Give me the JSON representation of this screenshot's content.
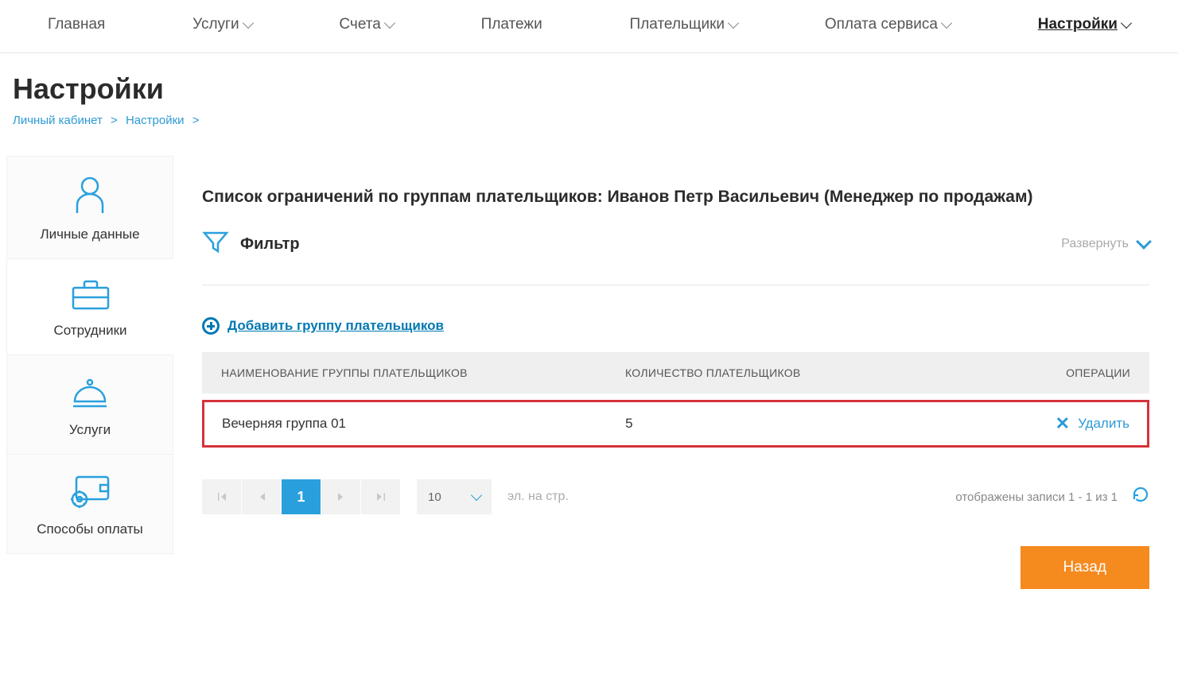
{
  "nav": {
    "items": [
      {
        "label": "Главная",
        "has_chevron": false
      },
      {
        "label": "Услуги",
        "has_chevron": true
      },
      {
        "label": "Счета",
        "has_chevron": true
      },
      {
        "label": "Платежи",
        "has_chevron": false
      },
      {
        "label": "Плательщики",
        "has_chevron": true
      },
      {
        "label": "Оплата сервиса",
        "has_chevron": true
      },
      {
        "label": "Настройки",
        "has_chevron": true,
        "active": true
      }
    ]
  },
  "page": {
    "title": "Настройки"
  },
  "breadcrumb": {
    "items": [
      "Личный кабинет",
      "Настройки"
    ],
    "sep": ">"
  },
  "sidebar": {
    "items": [
      {
        "label": "Личные данные"
      },
      {
        "label": "Сотрудники"
      },
      {
        "label": "Услуги"
      },
      {
        "label": "Способы оплаты"
      }
    ]
  },
  "content": {
    "title": "Список ограничений по группам плательщиков: Иванов Петр Васильевич (Менеджер по продажам)"
  },
  "filter": {
    "label": "Фильтр",
    "toggle": "Развернуть"
  },
  "add_link": {
    "label": "Добавить группу плательщиков"
  },
  "table": {
    "headers": {
      "name": "НАИМЕНОВАНИЕ ГРУППЫ ПЛАТЕЛЬЩИКОВ",
      "count": "КОЛИЧЕСТВО ПЛАТЕЛЬЩИКОВ",
      "ops": "ОПЕРАЦИИ"
    },
    "rows": [
      {
        "name": "Вечерняя группа 01",
        "count": "5",
        "op": "Удалить"
      }
    ]
  },
  "pager": {
    "current": "1",
    "page_size": "10",
    "per_page_label": "эл. на стр.",
    "summary": "отображены записи 1 - 1 из 1"
  },
  "buttons": {
    "back": "Назад"
  }
}
